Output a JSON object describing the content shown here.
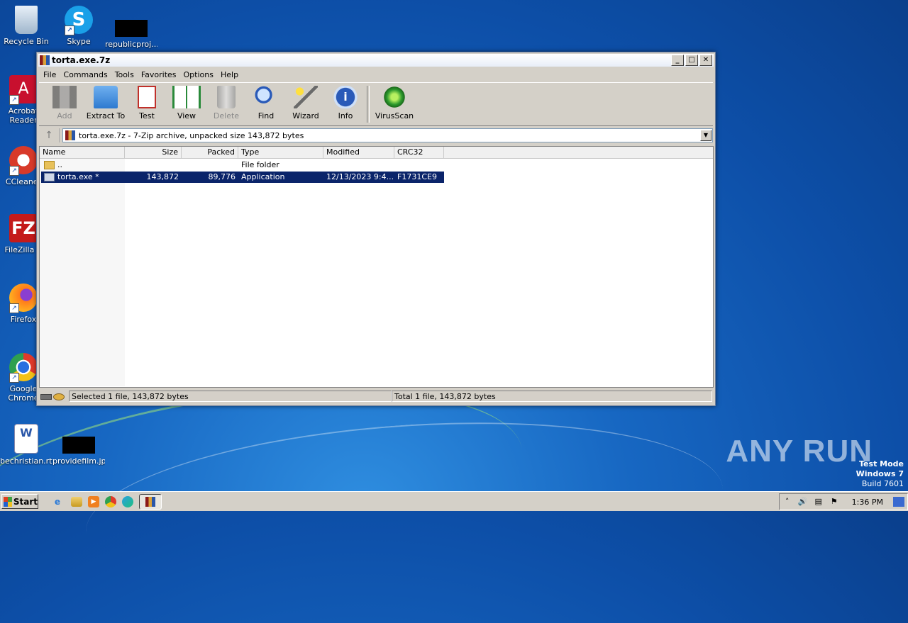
{
  "desktop": {
    "icons": [
      {
        "label": "Recycle Bin"
      },
      {
        "label": "Skype"
      },
      {
        "label": "republicproj..."
      },
      {
        "label": "Acrobat Reader"
      },
      {
        "label": "CCleaner"
      },
      {
        "label": "FileZilla C"
      },
      {
        "label": "Firefox"
      },
      {
        "label": "Google Chrome"
      },
      {
        "label": "bechristian.rtf"
      },
      {
        "label": "providefilm.jpg"
      }
    ],
    "watermark": "ANY RUN",
    "test_mode": {
      "line1": "Test Mode",
      "line2": "Windows 7",
      "line3": "Build 7601"
    }
  },
  "window": {
    "title": "torta.exe.7z",
    "controls": {
      "minimize": "_",
      "maximize": "□",
      "close": "✕"
    },
    "menu": [
      "File",
      "Commands",
      "Tools",
      "Favorites",
      "Options",
      "Help"
    ],
    "toolbar": [
      {
        "label": "Add",
        "icon": "add-icon",
        "disabled": true
      },
      {
        "label": "Extract To",
        "icon": "extract-icon"
      },
      {
        "label": "Test",
        "icon": "test-icon"
      },
      {
        "label": "View",
        "icon": "view-icon"
      },
      {
        "label": "Delete",
        "icon": "delete-icon",
        "disabled": true
      },
      {
        "label": "Find",
        "icon": "find-icon"
      },
      {
        "label": "Wizard",
        "icon": "wizard-icon"
      },
      {
        "label": "Info",
        "icon": "info-icon"
      },
      {
        "label": "VirusScan",
        "icon": "virusscan-icon"
      }
    ],
    "address": "torta.exe.7z - 7-Zip archive, unpacked size 143,872 bytes",
    "columns": [
      "Name",
      "Size",
      "Packed",
      "Type",
      "Modified",
      "CRC32"
    ],
    "rows": [
      {
        "name": "..",
        "size": "",
        "packed": "",
        "type": "File folder",
        "modified": "",
        "crc": ""
      },
      {
        "name": "torta.exe *",
        "size": "143,872",
        "packed": "89,776",
        "type": "Application",
        "modified": "12/13/2023 9:4...",
        "crc": "F1731CE9"
      }
    ],
    "status_left": "Selected 1 file, 143,872 bytes",
    "status_right": "Total 1 file, 143,872 bytes"
  },
  "taskbar": {
    "start_label": "Start",
    "clock": "1:36 PM"
  },
  "colors": {
    "selection": "#0a246a",
    "desktop": "#1767c2"
  }
}
